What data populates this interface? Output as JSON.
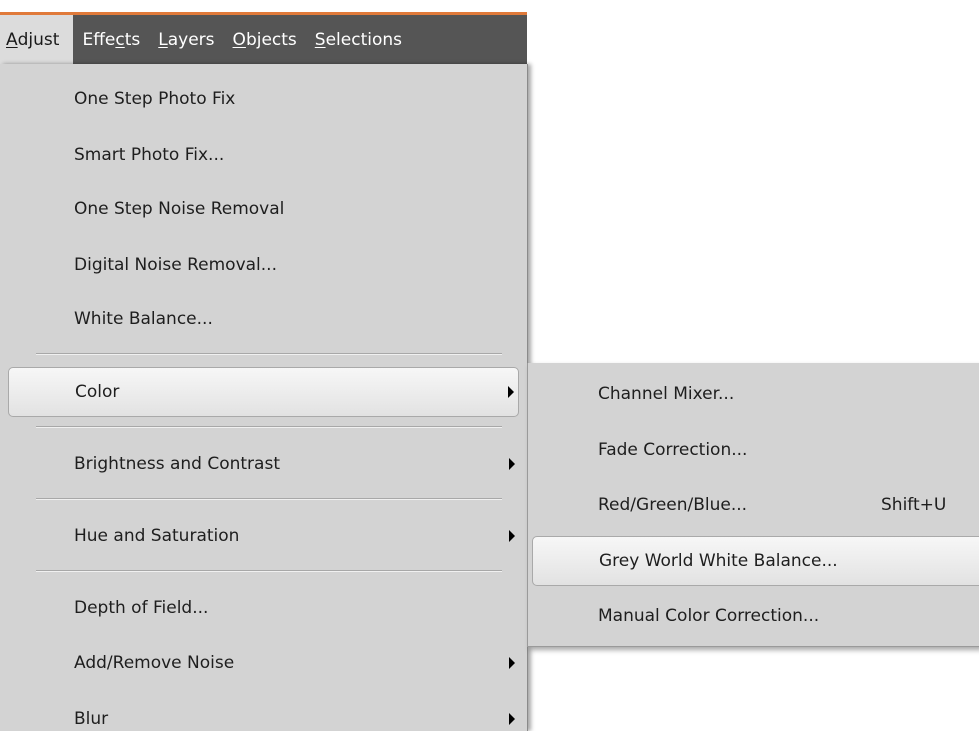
{
  "menubar": {
    "adjust": {
      "prefix": "",
      "accel": "A",
      "suffix": "djust"
    },
    "effects": {
      "prefix": "Effe",
      "accel": "c",
      "suffix": "ts"
    },
    "layers": {
      "prefix": "",
      "accel": "L",
      "suffix": "ayers"
    },
    "objects": {
      "prefix": "",
      "accel": "O",
      "suffix": "bjects"
    },
    "selections": {
      "prefix": "",
      "accel": "S",
      "suffix": "elections"
    }
  },
  "adjust_menu": {
    "items": [
      {
        "label": "One Step Photo Fix",
        "has_submenu": false
      },
      {
        "label": "Smart Photo Fix...",
        "has_submenu": false
      },
      {
        "label": "One Step Noise Removal",
        "has_submenu": false
      },
      {
        "label": "Digital Noise Removal...",
        "has_submenu": false
      },
      {
        "label": "White Balance...",
        "has_submenu": false
      },
      {
        "label": "Color",
        "has_submenu": true,
        "highlighted": true
      },
      {
        "label": "Brightness and Contrast",
        "has_submenu": true
      },
      {
        "label": "Hue and Saturation",
        "has_submenu": true
      },
      {
        "label": "Depth of Field...",
        "has_submenu": false
      },
      {
        "label": "Add/Remove Noise",
        "has_submenu": true
      },
      {
        "label": "Blur",
        "has_submenu": true
      }
    ]
  },
  "color_submenu": {
    "items": [
      {
        "label": "Channel Mixer...",
        "shortcut": ""
      },
      {
        "label": "Fade Correction...",
        "shortcut": ""
      },
      {
        "label": "Red/Green/Blue...",
        "shortcut": "Shift+U"
      },
      {
        "label": "Grey World White Balance...",
        "shortcut": "",
        "highlighted": true
      },
      {
        "label": "Manual Color Correction...",
        "shortcut": ""
      }
    ]
  },
  "colors": {
    "menubar_bg": "#555555",
    "menubar_accent": "#e07a3a",
    "menu_bg": "#d3d3d3",
    "highlight_bg": "#efefef"
  }
}
